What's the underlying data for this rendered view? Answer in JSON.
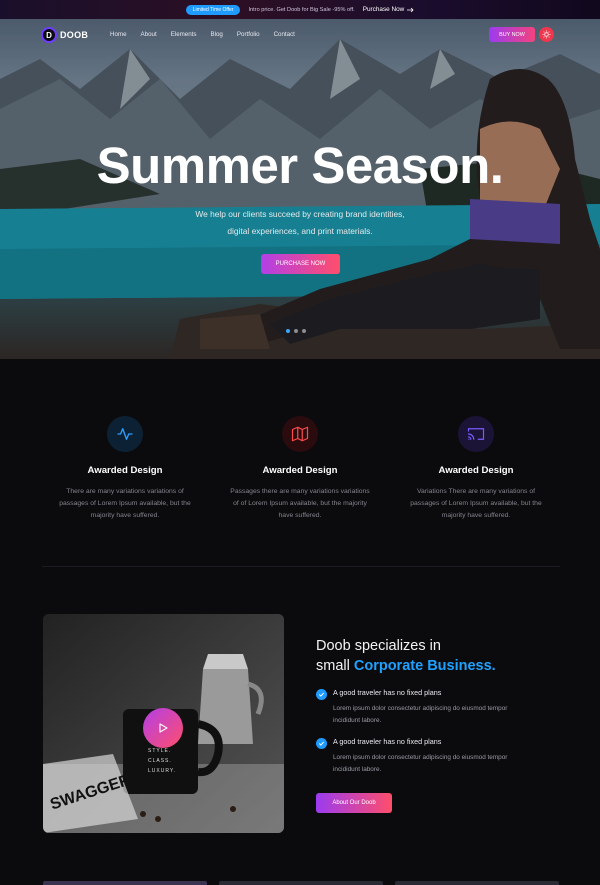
{
  "topbar": {
    "badge": "Limited Time Offer",
    "text": "Intro price. Get Doob for Big Sale -95% off.",
    "link": "Purchase Now",
    "link_icon": "arrow-right-icon"
  },
  "nav": {
    "logo_letter": "D",
    "logo_text": "DOOB",
    "links": [
      "Home",
      "About",
      "Elements",
      "Blog",
      "Portfolio",
      "Contact"
    ],
    "buy_label": "BUY NOW",
    "mode_icon": "sun-icon"
  },
  "hero": {
    "title": "Summer Season.",
    "subtitle_line1": "We help our clients succeed by creating brand identities,",
    "subtitle_line2": "digital experiences, and print materials.",
    "cta": "PURCHASE NOW"
  },
  "features": [
    {
      "icon": "activity-icon",
      "icon_color": "#2e9dff",
      "bg": "#0c2234",
      "title": "Awarded Design",
      "text": "There are many variations variations of passages of Lorem Ipsum available, but the majority have suffered."
    },
    {
      "icon": "map-icon",
      "icon_color": "#ff4a4a",
      "bg": "#2a0c0f",
      "title": "Awarded Design",
      "text": "Passages there are many variations variations of of Lorem Ipsum available, but the majority have suffered."
    },
    {
      "icon": "cast-icon",
      "icon_color": "#7a5bff",
      "bg": "#1b1436",
      "title": "Awarded Design",
      "text": "Variations There are many variations of passages of Lorem Ipsum available, but the majority have suffered."
    }
  ],
  "about": {
    "title_line1": "Doob specializes in",
    "title_prefix": "small ",
    "title_accent": "Corporate Business.",
    "items": [
      {
        "title": "A good traveler has no fixed plans",
        "text": "Lorem ipsum dolor consectetur adipiscing do eiusmod tempor incididunt labore."
      },
      {
        "title": "A good traveler has no fixed plans",
        "text": "Lorem ipsum dolor consectetur adipiscing do eiusmod tempor incididunt labore."
      }
    ],
    "button": "About Our Doob",
    "mug_text": [
      "STYLE.",
      "CLASS.",
      "LUXURY."
    ],
    "magazine_text": "SWAGGER"
  },
  "colors": {
    "accent_blue": "#1fa2ff",
    "gradient_start": "#9b3bf0",
    "gradient_end": "#ff4e6b"
  }
}
